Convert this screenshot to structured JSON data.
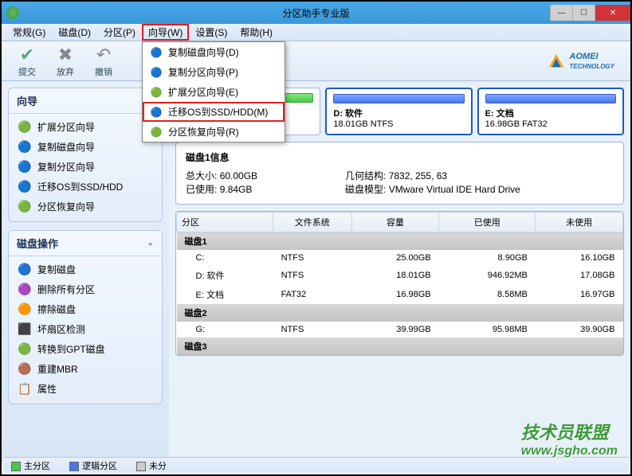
{
  "window": {
    "title": "分区助手专业版"
  },
  "menu": {
    "items": [
      "常规(G)",
      "磁盘(D)",
      "分区(P)",
      "向导(W)",
      "设置(S)",
      "帮助(H)"
    ],
    "highlighted_index": 3
  },
  "toolbar": {
    "submit": "提交",
    "discard": "放弃",
    "undo": "撤销",
    "brand": "AOMEI",
    "brand_sub": "TECHNOLOGY"
  },
  "dropdown": {
    "items": [
      {
        "icon": "🔵",
        "label": "复制磁盘向导(D)"
      },
      {
        "icon": "🔵",
        "label": "复制分区向导(P)"
      },
      {
        "icon": "🟢",
        "label": "扩展分区向导(E)"
      },
      {
        "icon": "🔵",
        "label": "迁移OS到SSD/HDD(M)"
      },
      {
        "icon": "🟢",
        "label": "分区恢复向导(R)"
      }
    ],
    "highlighted_index": 3
  },
  "sidebar": {
    "wizard_title": "向导",
    "wizard_items": [
      {
        "icon": "🟢",
        "label": "扩展分区向导"
      },
      {
        "icon": "🔵",
        "label": "复制磁盘向导"
      },
      {
        "icon": "🔵",
        "label": "复制分区向导"
      },
      {
        "icon": "🔵",
        "label": "迁移OS到SSD/HDD"
      },
      {
        "icon": "🟢",
        "label": "分区恢复向导"
      }
    ],
    "diskop_title": "磁盘操作",
    "diskop_items": [
      {
        "icon": "🔵",
        "label": "复制磁盘"
      },
      {
        "icon": "🟣",
        "label": "删除所有分区"
      },
      {
        "icon": "🟠",
        "label": "擦除磁盘"
      },
      {
        "icon": "⬛",
        "label": "坏扇区检测"
      },
      {
        "icon": "🟢",
        "label": "转换到GPT磁盘"
      },
      {
        "icon": "🟤",
        "label": "重建MBR"
      },
      {
        "icon": "📋",
        "label": "属性"
      }
    ]
  },
  "partitions": [
    {
      "name": "C:",
      "size": "25.00GB NTFS",
      "type": "primary"
    },
    {
      "name": "D: 软件",
      "size": "18.01GB NTFS",
      "type": "logical"
    },
    {
      "name": "E: 文档",
      "size": "16.98GB FAT32",
      "type": "logical"
    }
  ],
  "diskinfo": {
    "title": "磁盘1信息",
    "total_label": "总大小:",
    "total": "60.00GB",
    "used_label": "已使用:",
    "used": "9.84GB",
    "geom_label": "几何结构:",
    "geom": "7832, 255, 63",
    "model_label": "磁盘模型:",
    "model": "VMware Virtual IDE Hard Drive"
  },
  "table": {
    "headers": [
      "分区",
      "文件系统",
      "容量",
      "已使用",
      "未使用"
    ],
    "disks": [
      {
        "name": "磁盘1",
        "rows": [
          {
            "name": "C:",
            "fs": "NTFS",
            "cap": "25.00GB",
            "used": "8.90GB",
            "free": "16.10GB"
          },
          {
            "name": "D: 软件",
            "fs": "NTFS",
            "cap": "18.01GB",
            "used": "946.92MB",
            "free": "17.08GB"
          },
          {
            "name": "E: 文档",
            "fs": "FAT32",
            "cap": "16.98GB",
            "used": "8.58MB",
            "free": "16.97GB"
          }
        ]
      },
      {
        "name": "磁盘2",
        "rows": [
          {
            "name": "G:",
            "fs": "NTFS",
            "cap": "39.99GB",
            "used": "95.98MB",
            "free": "39.90GB"
          }
        ]
      },
      {
        "name": "磁盘3",
        "rows": []
      }
    ]
  },
  "legend": {
    "primary": "主分区",
    "logical": "逻辑分区",
    "unalloc": "未分"
  },
  "watermark": {
    "text": "技术员联盟",
    "url": "www.jsgho.com"
  }
}
